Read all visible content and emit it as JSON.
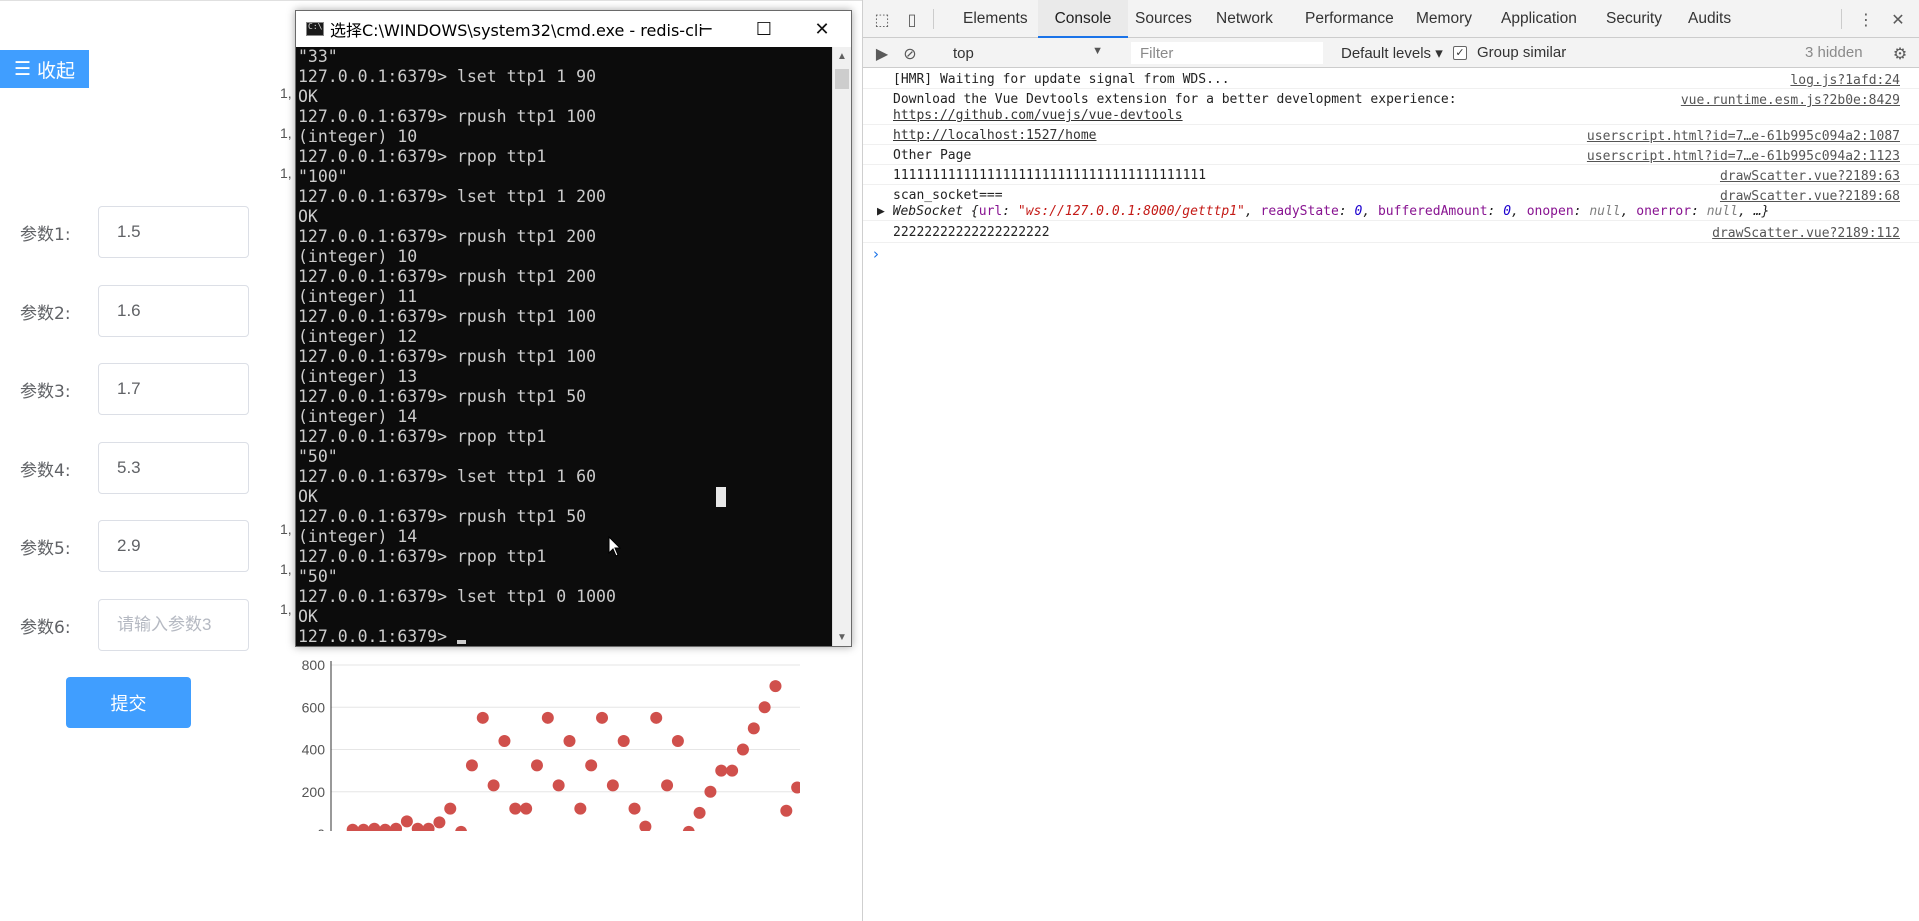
{
  "app": {
    "collapse_label": "收起",
    "submit_label": "提交",
    "params": [
      {
        "label": "参数1:",
        "value": "1.5",
        "placeholder": ""
      },
      {
        "label": "参数2:",
        "value": "1.6",
        "placeholder": ""
      },
      {
        "label": "参数3:",
        "value": "1.7",
        "placeholder": ""
      },
      {
        "label": "参数4:",
        "value": "5.3",
        "placeholder": ""
      },
      {
        "label": "参数5:",
        "value": "2.9",
        "placeholder": ""
      },
      {
        "label": "参数6:",
        "value": "",
        "placeholder": "请输入参数3"
      }
    ],
    "axis_fragments": [
      "1,",
      "1,",
      "1,",
      "1,",
      "1,",
      "1,"
    ]
  },
  "chart_data": {
    "type": "scatter",
    "ylim": [
      0,
      800
    ],
    "yticks": [
      "800",
      "600",
      "400",
      "200",
      "0"
    ],
    "color": "#d0504c",
    "points": [
      [
        1,
        20
      ],
      [
        2,
        20
      ],
      [
        3,
        25
      ],
      [
        4,
        20
      ],
      [
        5,
        25
      ],
      [
        6,
        60
      ],
      [
        7,
        25
      ],
      [
        8,
        25
      ],
      [
        9,
        55
      ],
      [
        10,
        120
      ],
      [
        11,
        10
      ],
      [
        12,
        325
      ],
      [
        13,
        550
      ],
      [
        14,
        230
      ],
      [
        15,
        440
      ],
      [
        16,
        120
      ],
      [
        17,
        120
      ],
      [
        18,
        325
      ],
      [
        19,
        550
      ],
      [
        20,
        230
      ],
      [
        21,
        440
      ],
      [
        22,
        120
      ],
      [
        23,
        325
      ],
      [
        24,
        550
      ],
      [
        25,
        230
      ],
      [
        26,
        440
      ],
      [
        27,
        120
      ],
      [
        28,
        35
      ],
      [
        29,
        550
      ],
      [
        30,
        230
      ],
      [
        31,
        440
      ],
      [
        32,
        10
      ],
      [
        33,
        100
      ],
      [
        34,
        200
      ],
      [
        35,
        300
      ],
      [
        36,
        300
      ],
      [
        37,
        400
      ],
      [
        38,
        500
      ],
      [
        39,
        600
      ],
      [
        40,
        700
      ],
      [
        41,
        110
      ],
      [
        42,
        220
      ]
    ],
    "xlim": [
      -1,
      43
    ]
  },
  "cmd": {
    "title": "选择C:\\WINDOWS\\system32\\cmd.exe - redis-cli",
    "lines": [
      "\"33\"",
      "127.0.0.1:6379> lset ttp1 1 90",
      "OK",
      "127.0.0.1:6379> rpush ttp1 100",
      "(integer) 10",
      "127.0.0.1:6379> rpop ttp1",
      "\"100\"",
      "127.0.0.1:6379> lset ttp1 1 200",
      "OK",
      "127.0.0.1:6379> rpush ttp1 200",
      "(integer) 10",
      "127.0.0.1:6379> rpush ttp1 200",
      "(integer) 11",
      "127.0.0.1:6379> rpush ttp1 100",
      "(integer) 12",
      "127.0.0.1:6379> rpush ttp1 100",
      "(integer) 13",
      "127.0.0.1:6379> rpush ttp1 50",
      "(integer) 14",
      "127.0.0.1:6379> rpop ttp1",
      "\"50\"",
      "127.0.0.1:6379> lset ttp1 1 60",
      "OK",
      "127.0.0.1:6379> rpush ttp1 50",
      "(integer) 14",
      "127.0.0.1:6379> rpop ttp1",
      "\"50\"",
      "127.0.0.1:6379> lset ttp1 0 1000",
      "OK",
      "127.0.0.1:6379> "
    ]
  },
  "devtools": {
    "tabs": [
      "Elements",
      "Console",
      "Sources",
      "Network",
      "Performance",
      "Memory",
      "Application",
      "Security",
      "Audits"
    ],
    "active_tab": "Console",
    "context": "top",
    "filter_placeholder": "Filter",
    "levels_label": "Default levels",
    "group_similar_label": "Group similar",
    "hidden_count": "3 hidden",
    "accent": "#1a73e8",
    "messages": [
      {
        "text": "[HMR] Waiting for update signal from WDS...",
        "source": "log.js?1afd:24"
      },
      {
        "text": "Download the Vue Devtools extension for a better development experience:",
        "link": "https://github.com/vuejs/vue-devtools",
        "source": "vue.runtime.esm.js?2b0e:8429"
      },
      {
        "link": "http://localhost:1527/home",
        "source": "userscript.html?id=7…e-61b995c094a2:1087"
      },
      {
        "text": "Other Page",
        "source": "userscript.html?id=7…e-61b995c094a2:1123"
      },
      {
        "text": "1111111111111111111111111111111111111111",
        "source": "drawScatter.vue?2189:63"
      },
      {
        "text": "scan_socket===",
        "source": "drawScatter.vue?2189:68"
      },
      {
        "text": "22222222222222222222",
        "source": "drawScatter.vue?2189:112"
      }
    ],
    "websocket": {
      "type": "WebSocket",
      "url_key": "url",
      "url": "\"ws://127.0.0.1:8000/getttp1\"",
      "ready_key": "readyState",
      "ready": "0",
      "buffered_key": "bufferedAmount",
      "buffered": "0",
      "onopen_key": "onopen",
      "onopen": "null",
      "onerror_key": "onerror",
      "onerror": "null"
    }
  }
}
